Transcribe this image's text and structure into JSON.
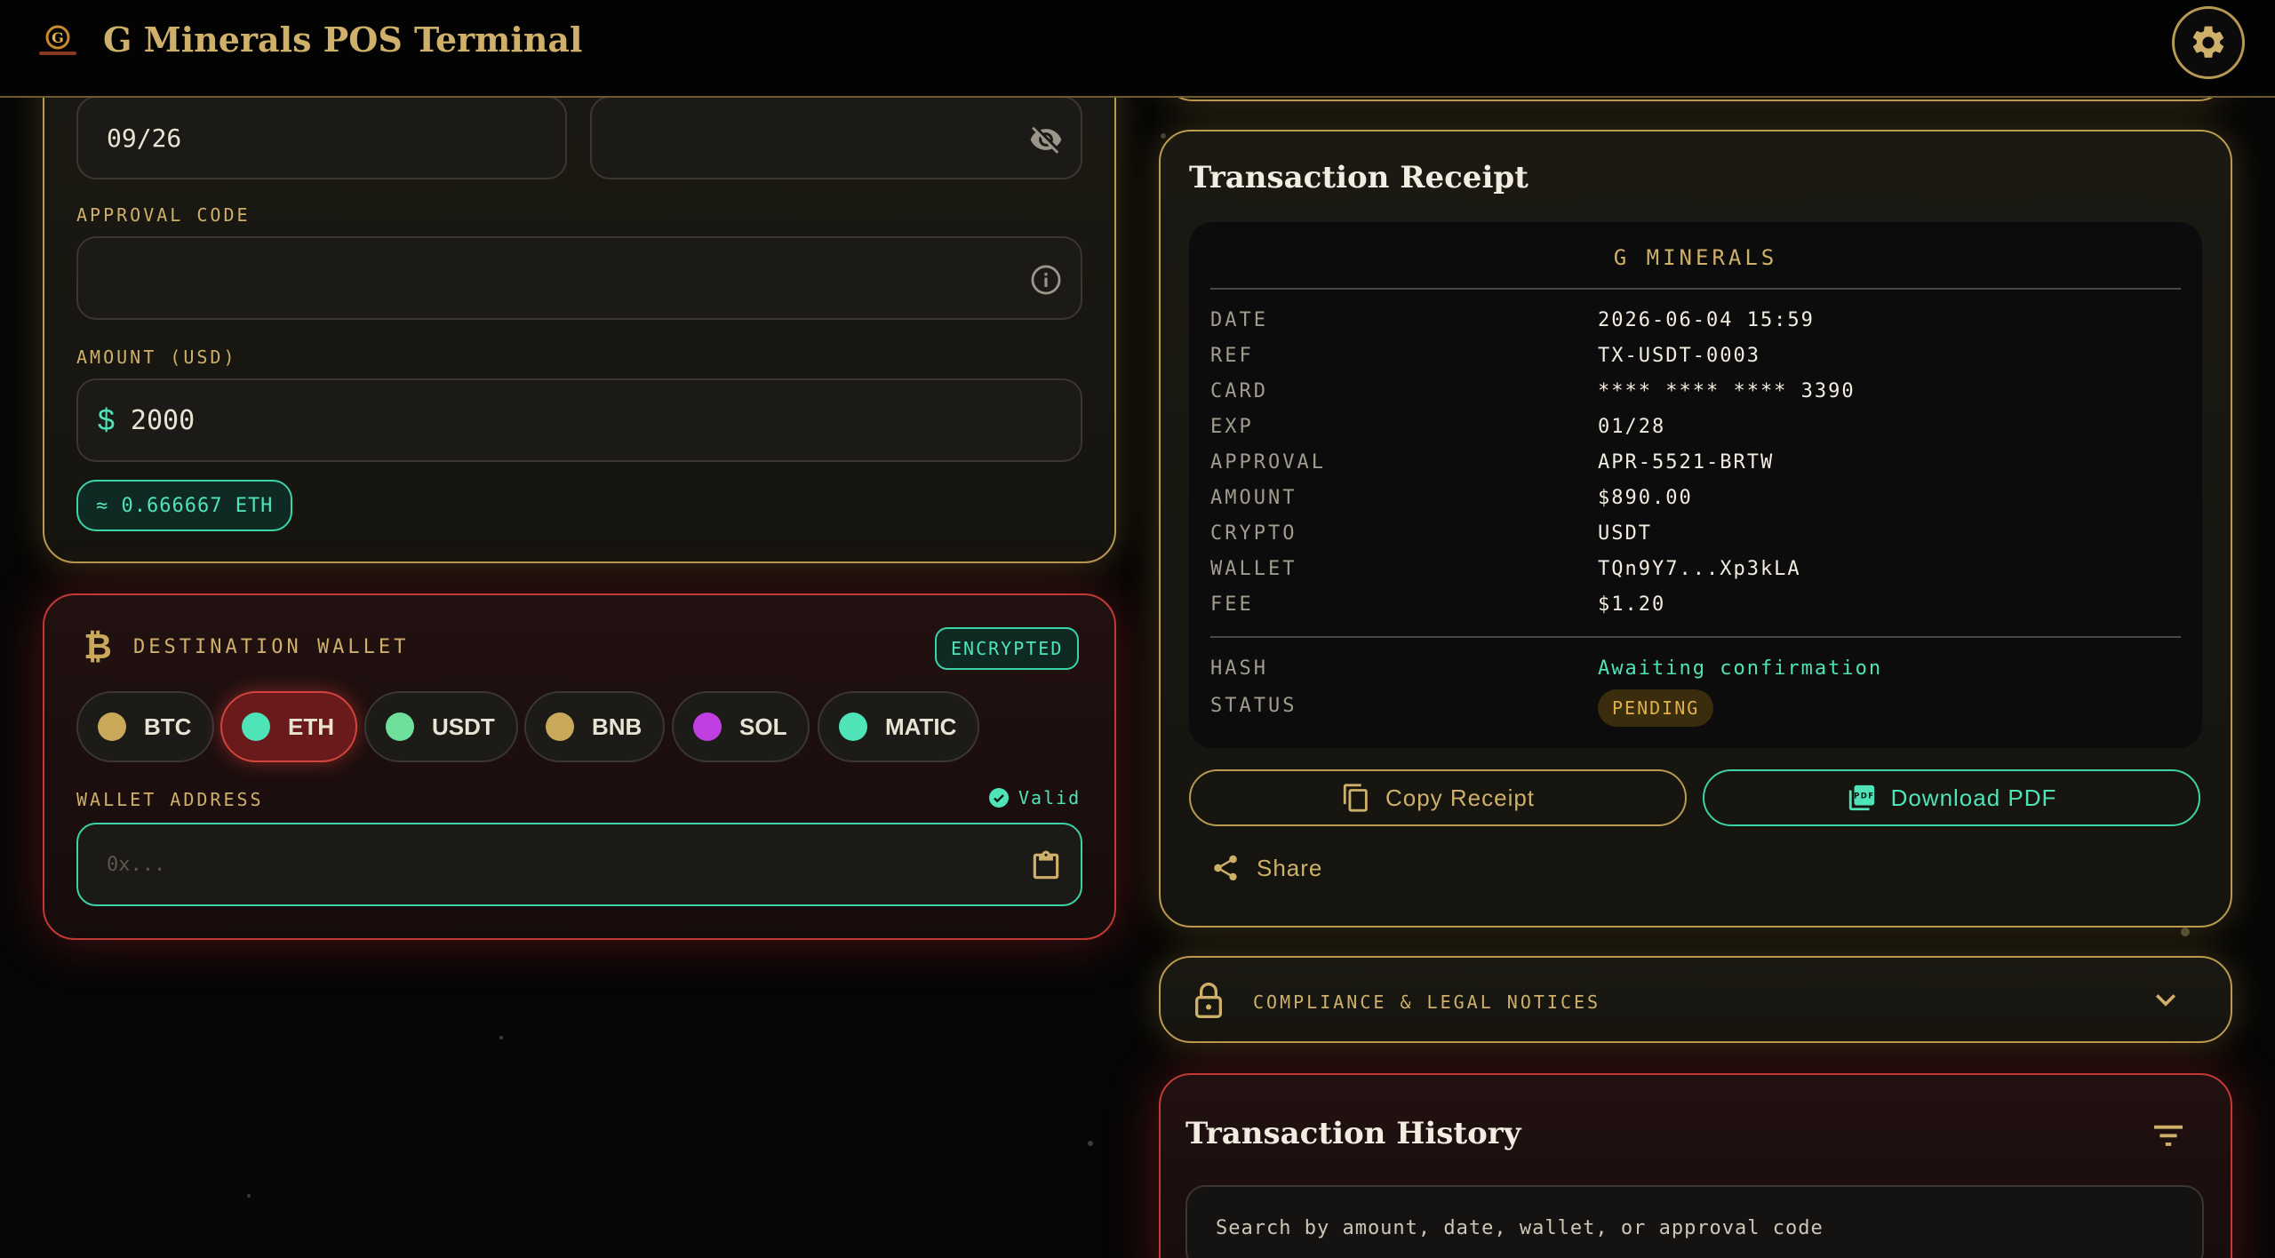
{
  "header": {
    "title": "G Minerals POS Terminal"
  },
  "payment": {
    "expiry_value": "09/26",
    "approval_label": "APPROVAL CODE",
    "amount_label": "AMOUNT (USD)",
    "currency_symbol": "$",
    "amount_value": "2000",
    "eth_approx": "≈ 0.666667 ETH"
  },
  "wallet": {
    "title": "DESTINATION WALLET",
    "badge": "ENCRYPTED",
    "coins": [
      {
        "label": "BTC",
        "color": "#c9a85a"
      },
      {
        "label": "ETH",
        "color": "#4fe3b8"
      },
      {
        "label": "USDT",
        "color": "#6fdf9c"
      },
      {
        "label": "BNB",
        "color": "#c9a85a"
      },
      {
        "label": "SOL",
        "color": "#c13fe0"
      },
      {
        "label": "MATIC",
        "color": "#4fe3b8"
      }
    ],
    "selected": "ETH",
    "address_label": "WALLET ADDRESS",
    "valid_label": "Valid",
    "address_placeholder": "0x..."
  },
  "receipt": {
    "title": "Transaction Receipt",
    "store": "G MINERALS",
    "rows": [
      {
        "key": "DATE",
        "value": "2026-06-04 15:59"
      },
      {
        "key": "REF",
        "value": "TX-USDT-0003"
      },
      {
        "key": "CARD",
        "value": "**** **** **** 3390"
      },
      {
        "key": "EXP",
        "value": "01/28"
      },
      {
        "key": "APPROVAL",
        "value": "APR-5521-BRTW"
      },
      {
        "key": "AMOUNT",
        "value": "$890.00"
      },
      {
        "key": "CRYPTO",
        "value": "USDT"
      },
      {
        "key": "WALLET",
        "value": "TQn9Y7...Xp3kLA"
      },
      {
        "key": "FEE",
        "value": "$1.20"
      }
    ],
    "hash_key": "HASH",
    "hash_value": "Awaiting confirmation",
    "status_key": "STATUS",
    "status_value": "PENDING",
    "copy_label": "Copy Receipt",
    "pdf_label": "Download PDF",
    "share_label": "Share"
  },
  "compliance": {
    "label": "COMPLIANCE & LEGAL NOTICES"
  },
  "history": {
    "title": "Transaction History",
    "search_placeholder": "Search by amount, date, wallet, or approval code"
  },
  "colors": {
    "gold": "#cfb06a",
    "teal": "#4fe3b8",
    "red": "#c13a36",
    "bg": "#060606"
  }
}
